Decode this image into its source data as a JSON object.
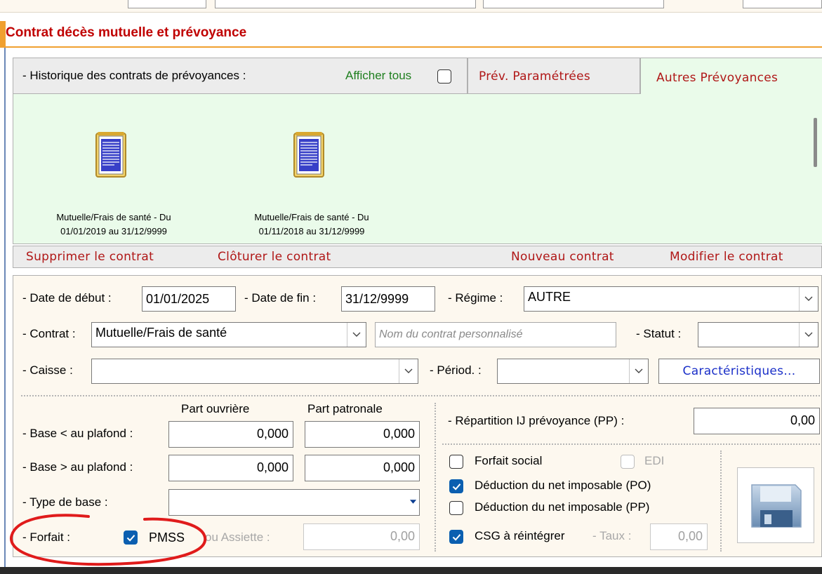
{
  "section_title": "Contrat décès mutuelle et prévoyance",
  "history": {
    "label": "- Historique des contrats de prévoyances :",
    "show_all": "Afficher tous",
    "show_all_checked": false,
    "tabs": [
      {
        "label": "Prév. Paramétrées",
        "active": false
      },
      {
        "label": "Autres Prévoyances",
        "active": true
      }
    ],
    "contracts": [
      {
        "icon": "document-icon",
        "line1": "Mutuelle/Frais de santé - Du",
        "line2": "01/01/2019 au 31/12/9999"
      },
      {
        "icon": "document-icon",
        "line1": "Mutuelle/Frais de santé - Du",
        "line2": "01/11/2018 au 31/12/9999"
      }
    ]
  },
  "actions": {
    "delete": "Supprimer le contrat",
    "close": "Clôturer le contrat",
    "new": "Nouveau contrat",
    "edit": "Modifier le contrat"
  },
  "form": {
    "date_debut_label": "- Date de début :",
    "date_debut_value": "01/01/2025",
    "date_fin_label": "- Date de fin :",
    "date_fin_value": "31/12/9999",
    "regime_label": "- Régime :",
    "regime_value": "AUTRE",
    "contrat_label": "- Contrat :",
    "contrat_value": "Mutuelle/Frais de santé",
    "contrat_nom_placeholder": "Nom du contrat personnalisé",
    "statut_label": "- Statut :",
    "statut_value": "",
    "caisse_label": "- Caisse :",
    "caisse_value": "",
    "periode_label": "- Périod. :",
    "periode_value": "",
    "caracteristiques_button": "Caractéristiques...",
    "part_ouvriere_header": "Part ouvrière",
    "part_patronale_header": "Part patronale",
    "base_inf_label": "- Base < au plafond :",
    "base_inf_ouvriere": "0,000",
    "base_inf_patronale": "0,000",
    "base_sup_label": "- Base > au plafond :",
    "base_sup_ouvriere": "0,000",
    "base_sup_patronale": "0,000",
    "type_base_label": "- Type de base :",
    "type_base_value": "",
    "forfait_label": "- Forfait :",
    "pmss_label": "PMSS",
    "pmss_checked": true,
    "ou_assiette_label": "ou Assiette :",
    "assiette_value": "0,00",
    "repartition_label": "- Répartition IJ prévoyance (PP) :",
    "repartition_value": "0,00",
    "forfait_social_label": "Forfait social",
    "forfait_social_checked": false,
    "edi_label": "EDI",
    "edi_checked": false,
    "deduction_po_label": "Déduction du net imposable (PO)",
    "deduction_po_checked": true,
    "deduction_pp_label": "Déduction du net imposable (PP)",
    "deduction_pp_checked": false,
    "csg_label": "CSG à réintégrer",
    "csg_checked": true,
    "taux_label": "- Taux :",
    "taux_value": "0,00",
    "save_icon": "floppy-disk-icon"
  },
  "colors": {
    "title_red": "#c00000",
    "accent_orange": "#f0a030",
    "action_red": "#b01717",
    "link_blue": "#1a2fc8",
    "green_text": "#1f7f1f",
    "history_bg": "#eafbea",
    "form_bg": "#fdf8ef",
    "annotation_red": "#e01b1b"
  }
}
